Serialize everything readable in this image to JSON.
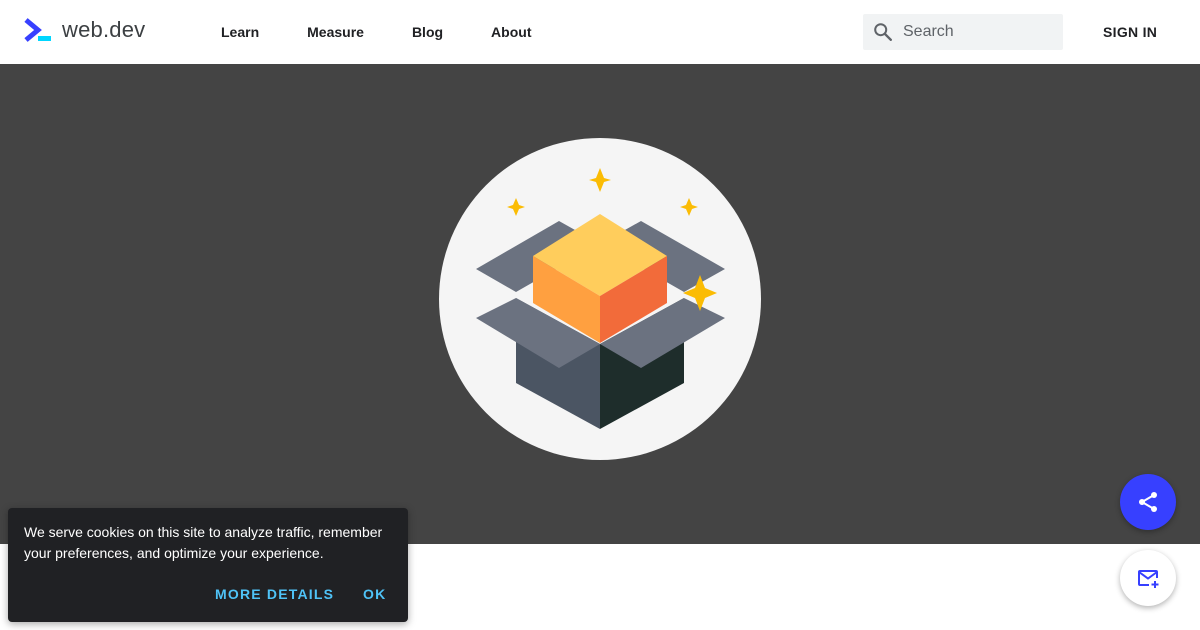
{
  "header": {
    "logo_text": "web.dev",
    "nav": [
      {
        "label": "Learn"
      },
      {
        "label": "Measure"
      },
      {
        "label": "Blog"
      },
      {
        "label": "About"
      }
    ],
    "search": {
      "placeholder": "Search",
      "value": ""
    },
    "sign_in_label": "SIGN IN"
  },
  "hero": {
    "illustration_icon": "open-box-sparkles-icon",
    "background_color": "#444444"
  },
  "fabs": {
    "share_icon": "share-icon",
    "subscribe_icon": "mail-add-icon",
    "share_color": "#3740ff"
  },
  "cookie_banner": {
    "message": "We serve cookies on this site to analyze traffic, remember your preferences, and optimize your experience.",
    "more_details_label": "MORE DETAILS",
    "ok_label": "OK",
    "accent_color": "#4fc3f7"
  },
  "colors": {
    "brand": "#3740ff",
    "header_bg": "#ffffff",
    "banner_bg": "#202124"
  }
}
